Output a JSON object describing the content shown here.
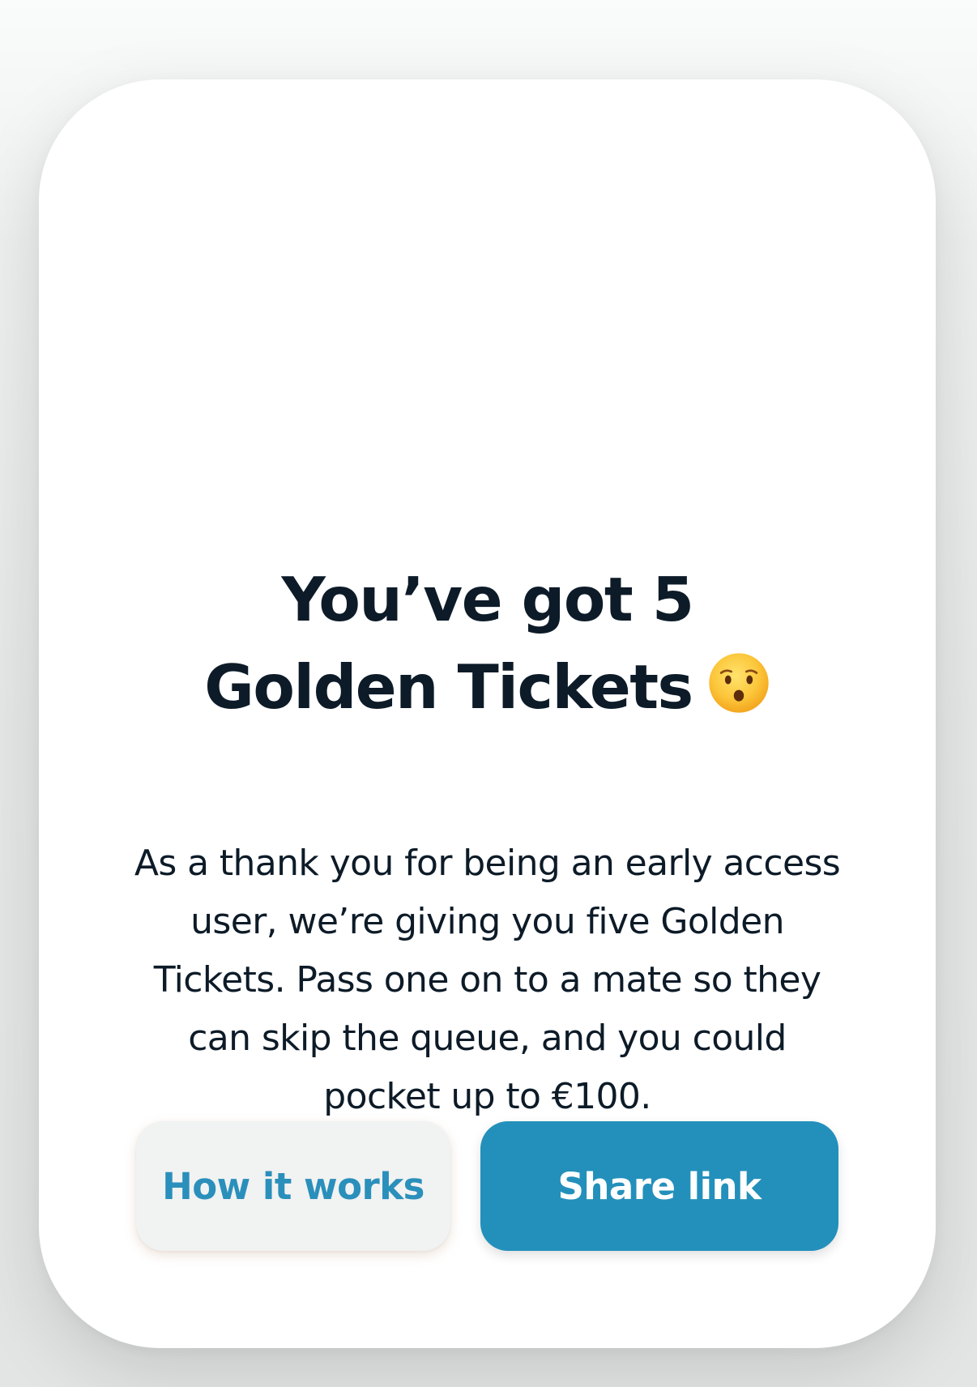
{
  "card": {
    "title_line1": "You’ve got 5",
    "title_line2": "Golden Tickets",
    "title_emoji_icon": "hushed-face-emoji",
    "body": "As a thank you for being an early access user, we’re giving you five Golden Tickets. Pass one on to a mate so they can skip the queue, and you could pocket up to €100."
  },
  "buttons": {
    "secondary_label": "How it works",
    "primary_label": "Share link"
  },
  "colors": {
    "text": "#0d1b28",
    "accent": "#2390bb",
    "secondary_button_bg": "#f1f2f2",
    "card_bg": "#ffffff"
  }
}
